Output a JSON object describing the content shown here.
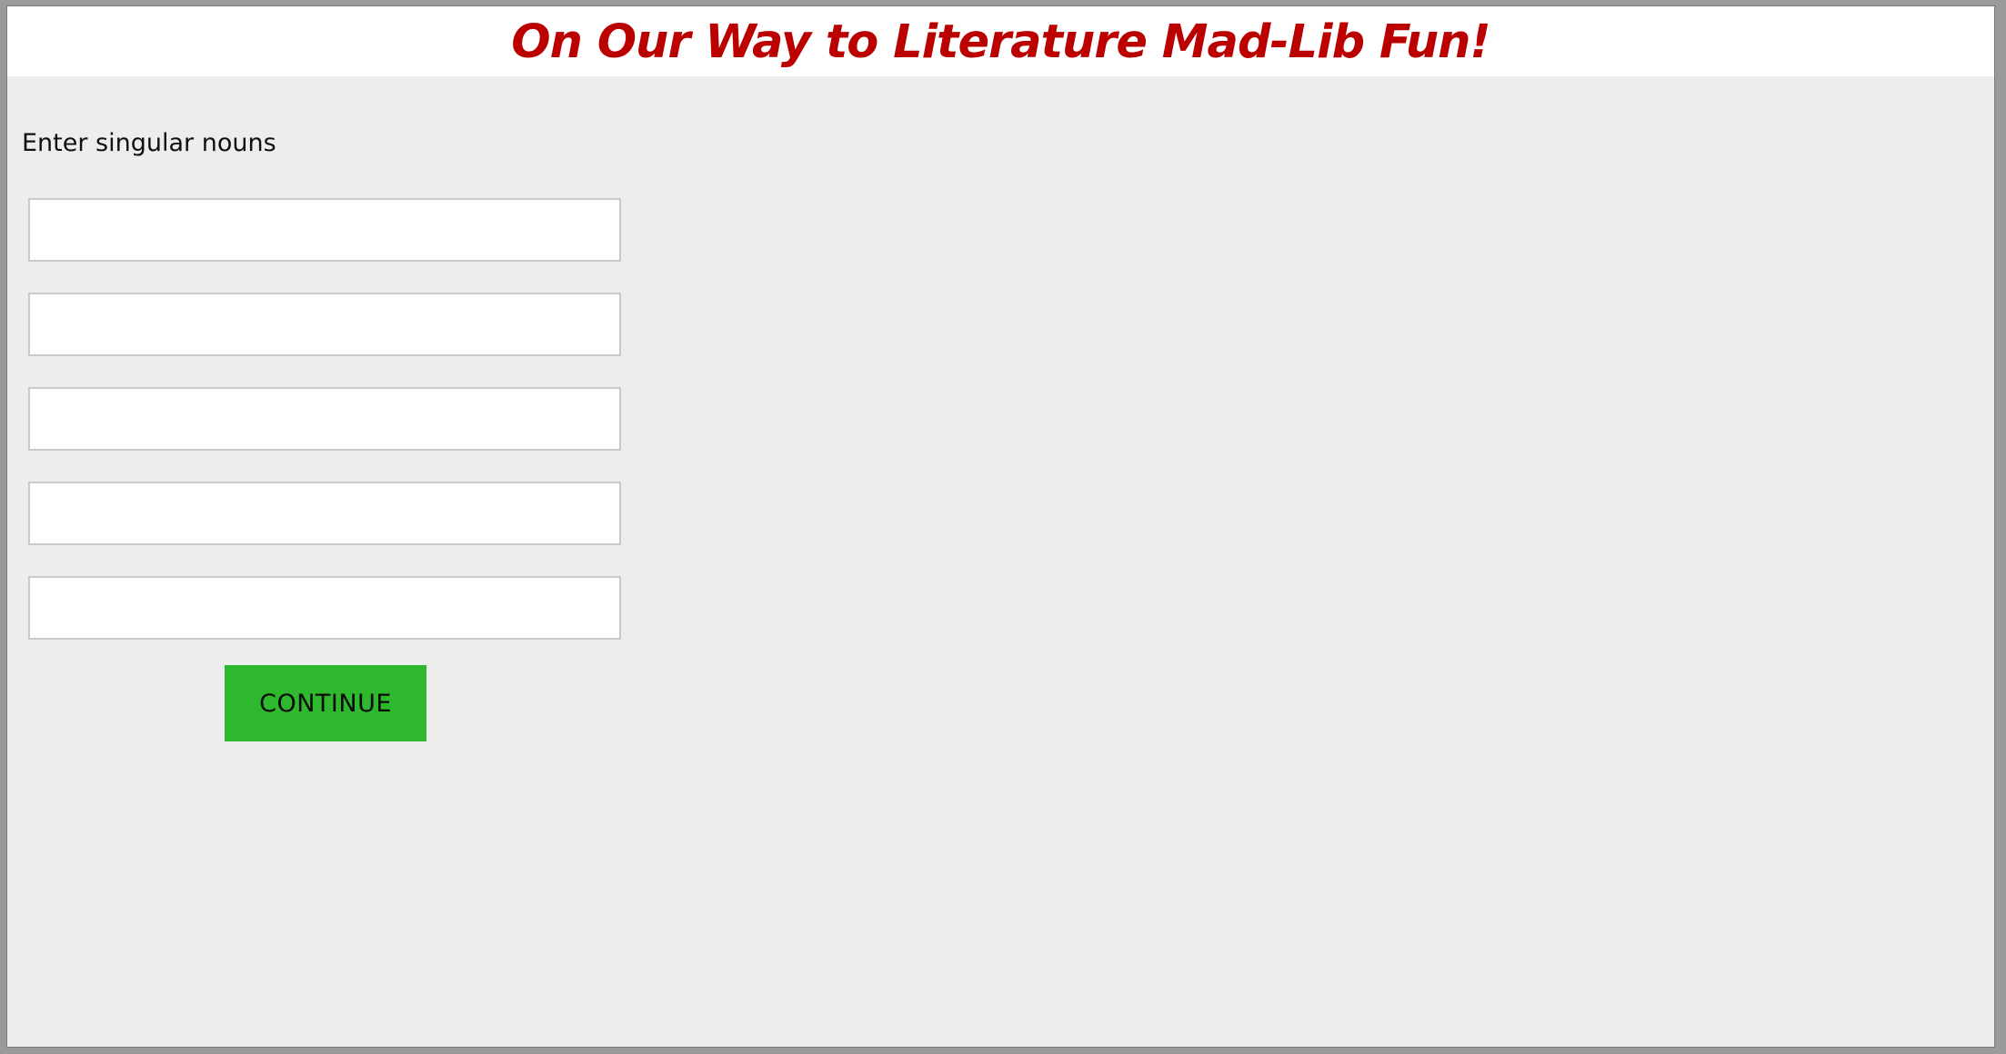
{
  "header": {
    "title": "On Our Way to Literature Mad-Lib Fun!"
  },
  "form": {
    "prompt": "Enter singular nouns",
    "inputs": [
      {
        "value": "",
        "placeholder": ""
      },
      {
        "value": "",
        "placeholder": ""
      },
      {
        "value": "",
        "placeholder": ""
      },
      {
        "value": "",
        "placeholder": ""
      },
      {
        "value": "",
        "placeholder": ""
      }
    ],
    "continue_label": "CONTINUE"
  },
  "colors": {
    "title": "#bb0000",
    "button": "#2eb82e",
    "background": "#ededed",
    "header_background": "#ffffff"
  }
}
